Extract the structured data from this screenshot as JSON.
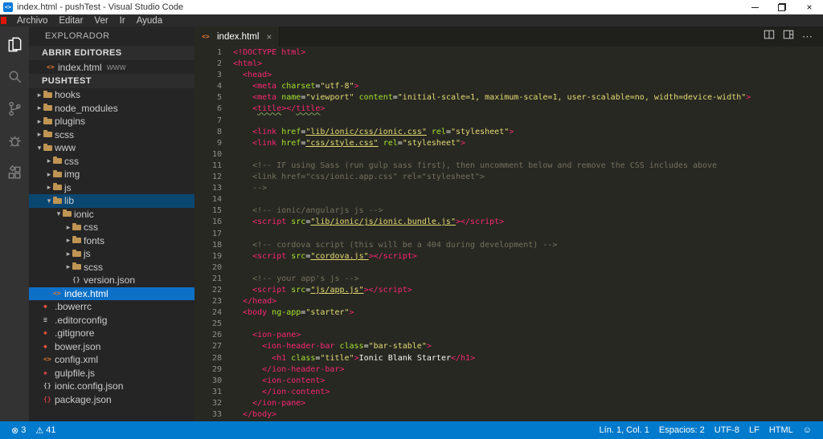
{
  "window": {
    "title": "index.html - pushTest - Visual Studio Code",
    "logo_glyph": "<>",
    "controls": {
      "minimize": "minimize",
      "restore": "restore",
      "close": "×"
    }
  },
  "menu": {
    "items": [
      "Archivo",
      "Editar",
      "Ver",
      "Ir",
      "Ayuda"
    ]
  },
  "activity_bar": {
    "items": [
      {
        "name": "explorer",
        "active": true
      },
      {
        "name": "search",
        "active": false
      },
      {
        "name": "source-control",
        "active": false
      },
      {
        "name": "debug",
        "active": false
      },
      {
        "name": "extensions",
        "active": false
      }
    ]
  },
  "sidebar": {
    "title": "EXPLORADOR",
    "open_editors": {
      "label": "ABRIR EDITORES",
      "items": [
        {
          "label": "index.html",
          "detail": "www",
          "icon": "html"
        }
      ]
    },
    "project": {
      "label": "PUSHTEST"
    },
    "tree": [
      {
        "label": "hooks",
        "level": 1,
        "type": "folder",
        "expanded": false
      },
      {
        "label": "node_modules",
        "level": 1,
        "type": "folder",
        "expanded": false
      },
      {
        "label": "plugins",
        "level": 1,
        "type": "folder",
        "expanded": false
      },
      {
        "label": "scss",
        "level": 1,
        "type": "folder",
        "expanded": false
      },
      {
        "label": "www",
        "level": 1,
        "type": "folder",
        "expanded": true
      },
      {
        "label": "css",
        "level": 2,
        "type": "folder",
        "expanded": false
      },
      {
        "label": "img",
        "level": 2,
        "type": "folder",
        "expanded": false
      },
      {
        "label": "js",
        "level": 2,
        "type": "folder",
        "expanded": false
      },
      {
        "label": "lib",
        "level": 2,
        "type": "folder",
        "expanded": true,
        "selected": "inactive"
      },
      {
        "label": "ionic",
        "level": 3,
        "type": "folder",
        "expanded": true
      },
      {
        "label": "css",
        "level": 4,
        "type": "folder",
        "expanded": false
      },
      {
        "label": "fonts",
        "level": 4,
        "type": "folder",
        "expanded": false
      },
      {
        "label": "js",
        "level": 4,
        "type": "folder",
        "expanded": false
      },
      {
        "label": "scss",
        "level": 4,
        "type": "folder",
        "expanded": false
      },
      {
        "label": "version.json",
        "level": 4,
        "type": "file",
        "icon": "json"
      },
      {
        "label": "index.html",
        "level": 2,
        "type": "file",
        "icon": "html",
        "selected": "active"
      },
      {
        "label": ".bowerrc",
        "level": 1,
        "type": "file",
        "icon": "bower"
      },
      {
        "label": ".editorconfig",
        "level": 1,
        "type": "file",
        "icon": "editorconfig"
      },
      {
        "label": ".gitignore",
        "level": 1,
        "type": "file",
        "icon": "git"
      },
      {
        "label": "bower.json",
        "level": 1,
        "type": "file",
        "icon": "bower"
      },
      {
        "label": "config.xml",
        "level": 1,
        "type": "file",
        "icon": "xml"
      },
      {
        "label": "gulpfile.js",
        "level": 1,
        "type": "file",
        "icon": "gulp"
      },
      {
        "label": "ionic.config.json",
        "level": 1,
        "type": "file",
        "icon": "json"
      },
      {
        "label": "package.json",
        "level": 1,
        "type": "file",
        "icon": "npm"
      }
    ]
  },
  "icons": {
    "chevron_collapsed": "▸",
    "chevron_expanded": "▾",
    "tab_close": "×",
    "more": "⋯",
    "error": "⊗",
    "warning": "⚠",
    "feedback": "☺",
    "file_glyphs": {
      "html": {
        "glyph": "<>",
        "color": "#e37933"
      },
      "xml": {
        "glyph": "<>",
        "color": "#e37933"
      },
      "json": {
        "glyph": "{}",
        "color": "#b3b3b3"
      },
      "bower": {
        "glyph": "◆",
        "color": "#ef5734"
      },
      "editorconfig": {
        "glyph": "≡",
        "color": "#c5c5c5"
      },
      "git": {
        "glyph": "◆",
        "color": "#dd4c35"
      },
      "gulp": {
        "glyph": "◆",
        "color": "#cc3e44"
      },
      "npm": {
        "glyph": "{}",
        "color": "#cc3e44"
      }
    }
  },
  "editor": {
    "tabs": [
      {
        "label": "index.html",
        "icon": "html",
        "active": true
      }
    ],
    "lines": [
      [
        [
          "t",
          "<!DOCTYPE html>"
        ]
      ],
      [
        [
          "t",
          "<html>"
        ]
      ],
      [
        [
          "x",
          "  "
        ],
        [
          "t",
          "<head>"
        ]
      ],
      [
        [
          "x",
          "    "
        ],
        [
          "t",
          "<meta "
        ],
        [
          "a",
          "charset"
        ],
        [
          "w",
          "="
        ],
        [
          "s",
          "\"utf-8\""
        ],
        [
          "t",
          ">"
        ]
      ],
      [
        [
          "x",
          "    "
        ],
        [
          "t",
          "<meta "
        ],
        [
          "a",
          "name"
        ],
        [
          "w",
          "="
        ],
        [
          "s",
          "\"viewport\""
        ],
        [
          "x",
          " "
        ],
        [
          "a",
          "content"
        ],
        [
          "w",
          "="
        ],
        [
          "s",
          "\"initial-scale=1, maximum-scale=1, user-scalable=no, width=device-width\""
        ],
        [
          "t",
          ">"
        ]
      ],
      [
        [
          "x",
          "    "
        ],
        [
          "t",
          "<"
        ],
        [
          "q",
          "title"
        ],
        [
          "t",
          "></"
        ],
        [
          "q",
          "title"
        ],
        [
          "t",
          ">"
        ]
      ],
      [],
      [
        [
          "x",
          "    "
        ],
        [
          "t",
          "<link "
        ],
        [
          "a",
          "href"
        ],
        [
          "w",
          "="
        ],
        [
          "u",
          "\"lib/ionic/css/ionic.css\""
        ],
        [
          "x",
          " "
        ],
        [
          "a",
          "rel"
        ],
        [
          "w",
          "="
        ],
        [
          "s",
          "\"stylesheet\""
        ],
        [
          "t",
          ">"
        ]
      ],
      [
        [
          "x",
          "    "
        ],
        [
          "t",
          "<link "
        ],
        [
          "a",
          "href"
        ],
        [
          "w",
          "="
        ],
        [
          "u",
          "\"css/style.css\""
        ],
        [
          "x",
          " "
        ],
        [
          "a",
          "rel"
        ],
        [
          "w",
          "="
        ],
        [
          "s",
          "\"stylesheet\""
        ],
        [
          "t",
          ">"
        ]
      ],
      [],
      [
        [
          "x",
          "    "
        ],
        [
          "c",
          "<!-- IF using Sass (run gulp sass first), then uncomment below and remove the CSS includes above"
        ]
      ],
      [
        [
          "x",
          "    "
        ],
        [
          "c",
          "<link href=\"css/ionic.app.css\" rel=\"stylesheet\">"
        ]
      ],
      [
        [
          "x",
          "    "
        ],
        [
          "c",
          "-->"
        ]
      ],
      [],
      [
        [
          "x",
          "    "
        ],
        [
          "c",
          "<!-- ionic/angularjs js -->"
        ]
      ],
      [
        [
          "x",
          "    "
        ],
        [
          "t",
          "<script "
        ],
        [
          "a",
          "src"
        ],
        [
          "w",
          "="
        ],
        [
          "u",
          "\"lib/ionic/js/ionic.bundle.js\""
        ],
        [
          "t",
          "></script>"
        ]
      ],
      [],
      [
        [
          "x",
          "    "
        ],
        [
          "c",
          "<!-- cordova script (this will be a 404 during development) -->"
        ]
      ],
      [
        [
          "x",
          "    "
        ],
        [
          "t",
          "<script "
        ],
        [
          "a",
          "src"
        ],
        [
          "w",
          "="
        ],
        [
          "u",
          "\"cordova.js\""
        ],
        [
          "t",
          "></script>"
        ]
      ],
      [],
      [
        [
          "x",
          "    "
        ],
        [
          "c",
          "<!-- your app's js -->"
        ]
      ],
      [
        [
          "x",
          "    "
        ],
        [
          "t",
          "<script "
        ],
        [
          "a",
          "src"
        ],
        [
          "w",
          "="
        ],
        [
          "u",
          "\"js/app.js\""
        ],
        [
          "t",
          "></script>"
        ]
      ],
      [
        [
          "x",
          "  "
        ],
        [
          "t",
          "</head>"
        ]
      ],
      [
        [
          "x",
          "  "
        ],
        [
          "t",
          "<body "
        ],
        [
          "a",
          "ng-app"
        ],
        [
          "w",
          "="
        ],
        [
          "s",
          "\"starter\""
        ],
        [
          "t",
          ">"
        ]
      ],
      [],
      [
        [
          "x",
          "    "
        ],
        [
          "t",
          "<ion-pane>"
        ]
      ],
      [
        [
          "x",
          "      "
        ],
        [
          "t",
          "<ion-header-bar "
        ],
        [
          "a",
          "class"
        ],
        [
          "w",
          "="
        ],
        [
          "s",
          "\"bar-stable\""
        ],
        [
          "t",
          ">"
        ]
      ],
      [
        [
          "x",
          "        "
        ],
        [
          "t",
          "<h1 "
        ],
        [
          "a",
          "class"
        ],
        [
          "w",
          "="
        ],
        [
          "s",
          "\"title\""
        ],
        [
          "t",
          ">"
        ],
        [
          "x",
          "Ionic Blank Starter"
        ],
        [
          "t",
          "</h1>"
        ]
      ],
      [
        [
          "x",
          "      "
        ],
        [
          "t",
          "</ion-header-bar>"
        ]
      ],
      [
        [
          "x",
          "      "
        ],
        [
          "t",
          "<ion-content>"
        ]
      ],
      [
        [
          "x",
          "      "
        ],
        [
          "t",
          "</ion-content>"
        ]
      ],
      [
        [
          "x",
          "    "
        ],
        [
          "t",
          "</ion-pane>"
        ]
      ],
      [
        [
          "x",
          "  "
        ],
        [
          "t",
          "</body>"
        ]
      ]
    ]
  },
  "status_bar": {
    "errors": "3",
    "warnings": "41",
    "right_items": [
      "Lín. 1, Col. 1",
      "Espacios: 2",
      "UTF-8",
      "LF",
      "HTML"
    ]
  },
  "colors": {
    "accent": "#007acc",
    "selection_active": "#0d70c7",
    "selection_inactive": "#094771",
    "editor_bg": "#272822"
  }
}
